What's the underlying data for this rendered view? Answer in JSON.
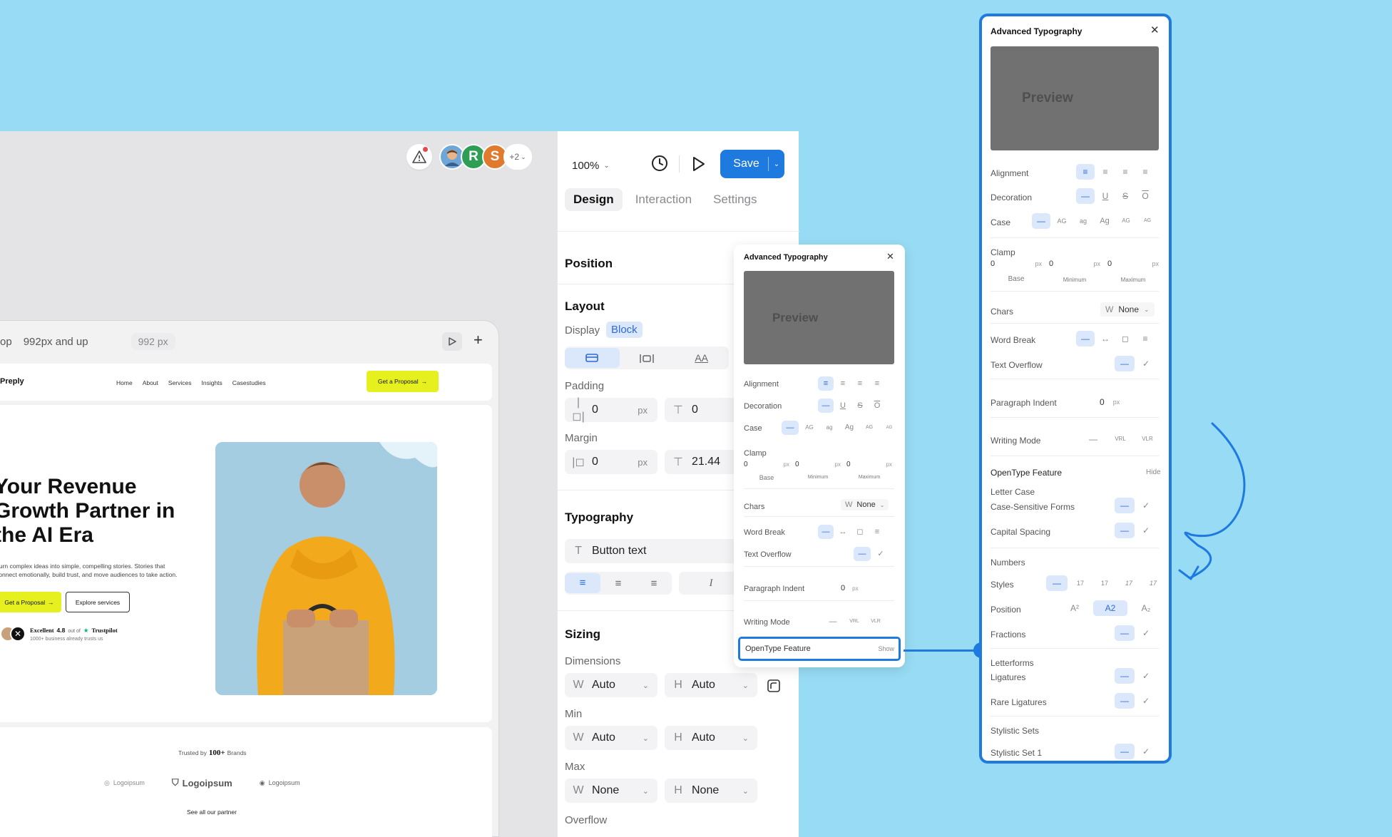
{
  "collab": {
    "avatars": [
      {
        "letter": "",
        "color": "#6fa6d8"
      },
      {
        "letter": "R",
        "color": "#2f9e55"
      },
      {
        "letter": "S",
        "color": "#e07a2e"
      }
    ],
    "more": "+2"
  },
  "frame": {
    "breakpoint_label": "992px and up",
    "width_pill": "992 px",
    "prefix": "op"
  },
  "site": {
    "brand": "Preply",
    "nav": [
      "Home",
      "About",
      "Services",
      "Insights",
      "Casestudies"
    ],
    "cta": "Get a Proposal",
    "hero_title": "Your Revenue\nGrowth Partner in\nthe AI Era",
    "hero_sub": "Turn complex ideas into simple, compelling stories. Stories that connect emotionally, build trust, and move audiences to take action.",
    "primary_btn": "Get a Proposal",
    "secondary_btn": "Explore services",
    "rating_word": "Excellent",
    "rating_value": "4.8",
    "rating_outof": "out of",
    "trustpilot": "Trustpilot",
    "trust_note": "1000+ business already trusts us",
    "trusted_prefix": "Trusted by",
    "trusted_count": "100+",
    "trusted_suffix": "Brands",
    "logos": [
      "Logoipsum",
      "Logoipsum",
      "Logoipsum"
    ],
    "partners_link": "See all our partner"
  },
  "toolbar": {
    "zoom": "100%",
    "save": "Save"
  },
  "tabs": [
    "Design",
    "Interaction",
    "Settings"
  ],
  "panel": {
    "position_title": "Position",
    "layout_title": "Layout",
    "display_label": "Display",
    "display_value": "Block",
    "padding_label": "Padding",
    "padding_left": "0",
    "padding_top": "0",
    "margin_label": "Margin",
    "margin_left": "0",
    "margin_top": "21.44",
    "unit": "px",
    "typography_title": "Typography",
    "font_style": "Button text",
    "sizing_title": "Sizing",
    "dimensions_label": "Dimensions",
    "min_label": "Min",
    "max_label": "Max",
    "overflow_label": "Overflow",
    "w": "W",
    "h": "H",
    "auto": "Auto",
    "none": "None"
  },
  "typo_small": {
    "title": "Advanced Typography",
    "preview": "Preview",
    "alignment": "Alignment",
    "decoration": "Decoration",
    "case": "Case",
    "clamp": "Clamp",
    "clamp_values": [
      "0",
      "0",
      "0"
    ],
    "clamp_unit": "px",
    "clamp_captions": [
      "Base",
      "Minimum",
      "Maximum"
    ],
    "chars": "Chars",
    "chars_w": "W",
    "chars_value": "None",
    "word_break": "Word Break",
    "text_overflow": "Text Overflow",
    "paragraph_indent": "Paragraph Indent",
    "indent_value": "0",
    "indent_unit": "px",
    "writing_mode": "Writing Mode",
    "opentype": "OpenType Feature",
    "opentype_action": "Show",
    "case_opts": [
      "AG",
      "ag",
      "Ag",
      "AG",
      "AG"
    ],
    "writing_opts": [
      "VRL",
      "VLR"
    ]
  },
  "typo_large": {
    "title": "Advanced Typography",
    "preview": "Preview",
    "alignment": "Alignment",
    "decoration": "Decoration",
    "case": "Case",
    "clamp": "Clamp",
    "clamp_values": [
      "0",
      "0",
      "0"
    ],
    "clamp_unit": "px",
    "clamp_captions": [
      "Base",
      "Minimum",
      "Maximum"
    ],
    "chars": "Chars",
    "chars_w": "W",
    "chars_value": "None",
    "word_break": "Word Break",
    "text_overflow": "Text Overflow",
    "paragraph_indent": "Paragraph Indent",
    "indent_value": "0",
    "indent_unit": "px",
    "writing_mode": "Writing Mode",
    "opentype": "OpenType Feature",
    "opentype_action": "Hide",
    "letter_case": "Letter Case",
    "case_sensitive": "Case-Sensitive Forms",
    "capital_spacing": "Capital Spacing",
    "numbers": "Numbers",
    "styles": "Styles",
    "styles_opts": [
      "17",
      "17",
      "17",
      "17"
    ],
    "position": "Position",
    "position_opts": [
      "A²",
      "A2",
      "A₂"
    ],
    "fractions": "Fractions",
    "letterforms": "Letterforms",
    "ligatures": "Ligatures",
    "rare_ligatures": "Rare Ligatures",
    "stylistic_sets": "Stylistic Sets",
    "stylistic_set_1": "Stylistic Set 1",
    "case_opts": [
      "AG",
      "ag",
      "Ag",
      "AG",
      "AG"
    ],
    "writing_opts": [
      "VRL",
      "VLR"
    ]
  },
  "colors": {
    "accent": "#1f7ae0",
    "highlight": "#2a86ec",
    "cta_yellow": "#e6f01e",
    "bg": "#97dcf4",
    "preview_gray": "#717171"
  }
}
